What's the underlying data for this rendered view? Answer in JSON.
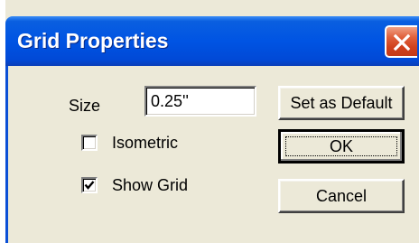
{
  "dialog": {
    "title": "Grid Properties",
    "close_icon": "close-icon",
    "size": {
      "label": "Size",
      "value": "0.25''"
    },
    "checkboxes": [
      {
        "label": "Isometric",
        "checked": false
      },
      {
        "label": "Show Grid",
        "checked": true
      }
    ],
    "buttons": {
      "set_default": "Set as Default",
      "ok": "OK",
      "cancel": "Cancel"
    }
  },
  "colors": {
    "titlebar": "#0054e3",
    "dialog_bg": "#ece9d8",
    "close_button": "#d0401c"
  }
}
